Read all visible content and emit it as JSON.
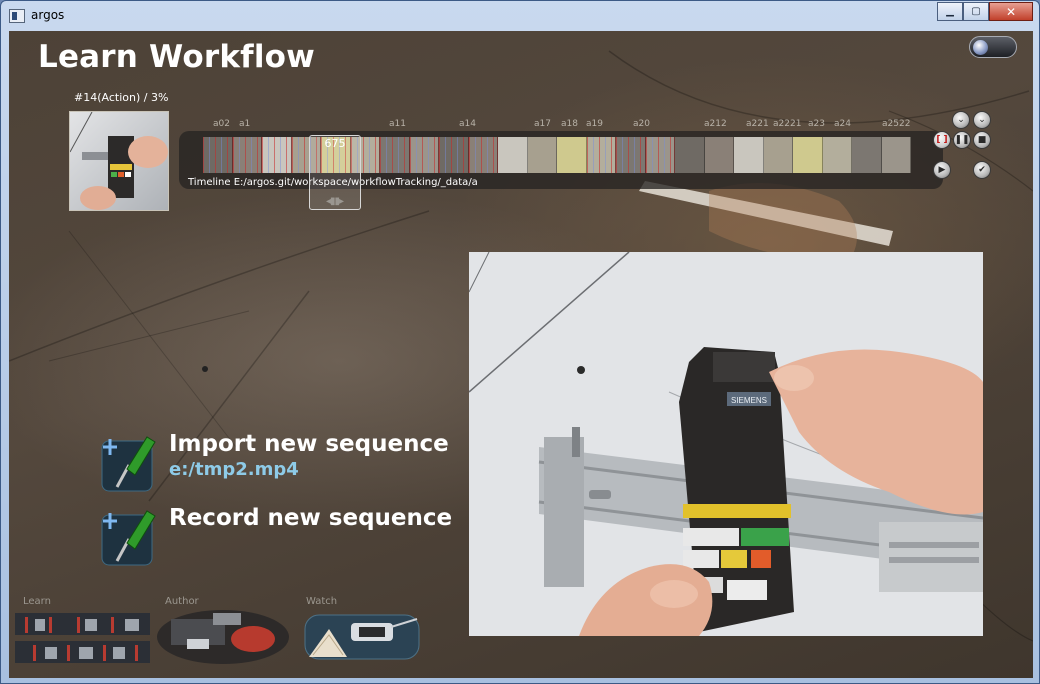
{
  "window": {
    "title": "argos",
    "minimize_label": "▁",
    "maximize_label": "▢",
    "close_label": "✕"
  },
  "page": {
    "title": "Learn Workflow"
  },
  "action": {
    "label": "#14(Action) / 3%"
  },
  "timeline": {
    "path_label": "Timeline E:/argos.git/workspace/workflowTracking/_data/a",
    "cursor_value": "675",
    "markers": [
      "a02",
      "a1",
      "a11",
      "a14",
      "a17",
      "a18",
      "a19",
      "a20",
      "a212",
      "a221",
      "a2221",
      "a23",
      "a24",
      "a2522"
    ],
    "progress_fraction": 0.03
  },
  "controls": {
    "down1_icon": "chevron-down-icon",
    "down2_icon": "chevron-down-icon",
    "record_icon": "record-icon",
    "pause_icon": "pause-icon",
    "stop_icon": "stop-icon",
    "play_icon": "play-icon",
    "confirm_icon": "checkmark-icon"
  },
  "menu": {
    "import_title": "Import new sequence",
    "import_file": "e:/tmp2.mp4",
    "record_title": "Record new sequence"
  },
  "modes": {
    "learn_label": "Learn",
    "author_label": "Author",
    "watch_label": "Watch"
  },
  "video": {
    "device_label": "SIEMENS"
  },
  "colors": {
    "accent_blue": "#8ecbe8",
    "title_text": "#ffffff",
    "record_red": "#c01818",
    "screwdriver_green": "#2f9b2a"
  }
}
